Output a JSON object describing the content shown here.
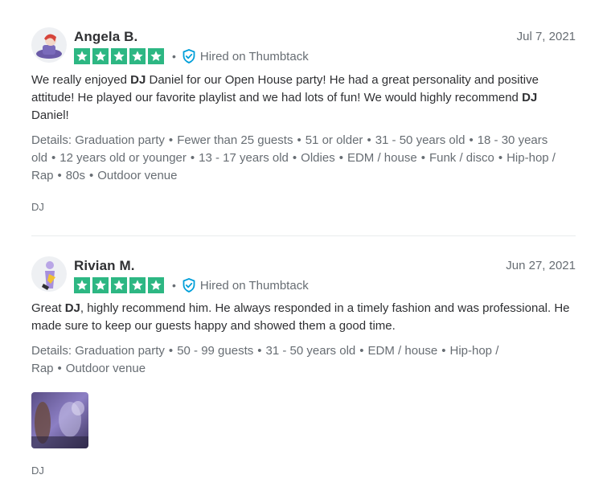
{
  "reviews": [
    {
      "name": "Angela B.",
      "date": "Jul 7, 2021",
      "rating": 5,
      "hired_label": "Hired on Thumbtack",
      "text_parts": [
        "We really enjoyed ",
        "DJ",
        " Daniel for our Open House party! He had a great personality and positive attitude! He played our favorite playlist and we had lots of fun! We would highly recommend ",
        "DJ",
        " Daniel!"
      ],
      "details_label": "Details: ",
      "details": [
        "Graduation party",
        "Fewer than 25 guests",
        "51 or older",
        "31 - 50 years old",
        "18 - 30 years old",
        "12 years old or younger",
        "13 - 17 years old",
        "Oldies",
        "EDM / house",
        "Funk / disco",
        "Hip-hop / Rap",
        "80s",
        "Outdoor venue"
      ],
      "category": "DJ"
    },
    {
      "name": "Rivian M.",
      "date": "Jun 27, 2021",
      "rating": 5,
      "hired_label": "Hired on Thumbtack",
      "text_parts": [
        "Great ",
        "DJ",
        ", highly recommend him. He always responded in a timely fashion and was professional. He made sure to keep our guests happy and showed them a good time."
      ],
      "details_label": "Details: ",
      "details": [
        "Graduation party",
        "50 - 99 guests",
        "31 - 50 years old",
        "EDM / house",
        "Hip-hop / Rap",
        "Outdoor venue"
      ],
      "category": "DJ"
    }
  ],
  "colors": {
    "star_green": "#2db783",
    "shield_blue": "#009fd9",
    "text_dark": "#2f3033",
    "text_muted": "#676d73"
  },
  "icons": [
    "star-icon",
    "shield-check-icon",
    "avatar-icon"
  ]
}
